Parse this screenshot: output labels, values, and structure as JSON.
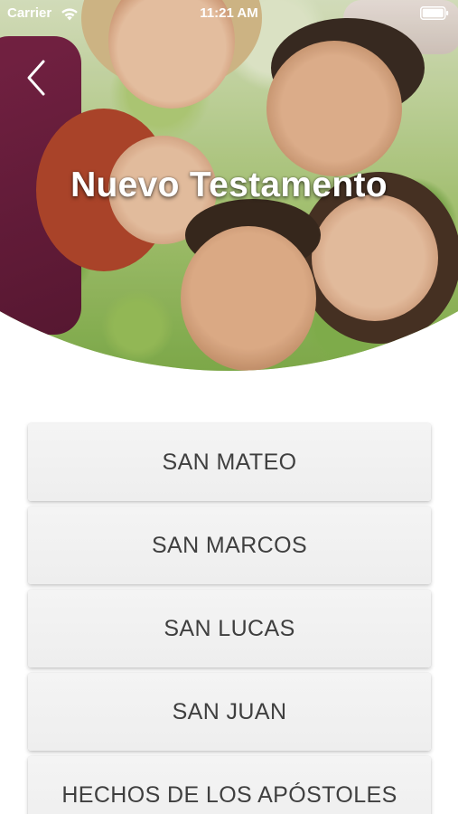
{
  "status_bar": {
    "carrier": "Carrier",
    "time": "11:21 AM",
    "wifi_icon": "wifi-icon",
    "battery_icon": "battery-icon",
    "text_color": "#ffffff"
  },
  "header": {
    "title": "Nuevo Testamento",
    "back_icon": "chevron-left-icon"
  },
  "books": [
    {
      "label": "SAN MATEO"
    },
    {
      "label": "SAN MARCOS"
    },
    {
      "label": "SAN LUCAS"
    },
    {
      "label": "SAN JUAN"
    },
    {
      "label": "HECHOS DE LOS APÓSTOLES"
    }
  ],
  "colors": {
    "button_background": "#f1f1f1",
    "button_text": "#3f3f3f",
    "title_text": "#ffffff"
  }
}
